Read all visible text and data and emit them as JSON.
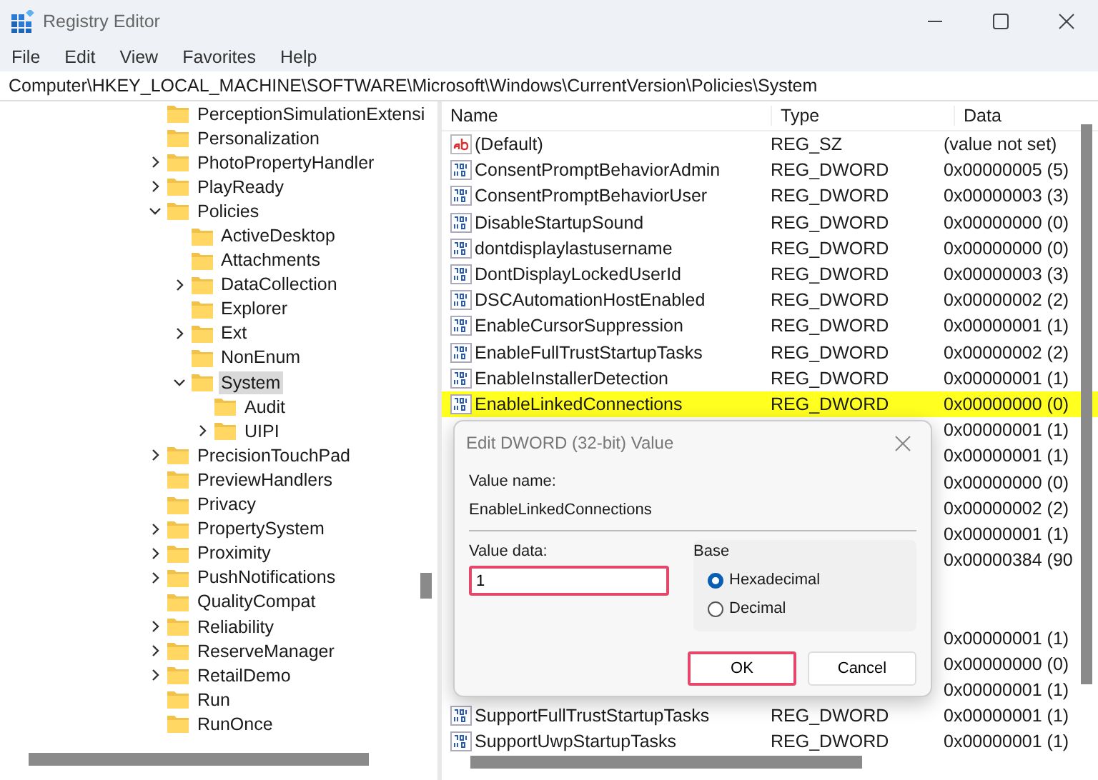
{
  "window": {
    "title": "Registry Editor"
  },
  "menu": [
    "File",
    "Edit",
    "View",
    "Favorites",
    "Help"
  ],
  "address": "Computer\\HKEY_LOCAL_MACHINE\\SOFTWARE\\Microsoft\\Windows\\CurrentVersion\\Policies\\System",
  "tree": [
    {
      "label": "PerceptionSimulationExtensi",
      "has_children": false,
      "selected": false
    },
    {
      "label": "Personalization",
      "has_children": false,
      "selected": false
    },
    {
      "label": "PhotoPropertyHandler",
      "has_children": true,
      "expanded": false,
      "selected": false
    },
    {
      "label": "PlayReady",
      "has_children": true,
      "expanded": false,
      "selected": false
    },
    {
      "label": "Policies",
      "has_children": true,
      "expanded": true,
      "selected": false,
      "children": [
        {
          "label": "ActiveDesktop",
          "has_children": false,
          "selected": false
        },
        {
          "label": "Attachments",
          "has_children": false,
          "selected": false
        },
        {
          "label": "DataCollection",
          "has_children": true,
          "expanded": false,
          "selected": false
        },
        {
          "label": "Explorer",
          "has_children": false,
          "selected": false
        },
        {
          "label": "Ext",
          "has_children": true,
          "expanded": false,
          "selected": false
        },
        {
          "label": "NonEnum",
          "has_children": false,
          "selected": false
        },
        {
          "label": "System",
          "has_children": true,
          "expanded": true,
          "selected": true,
          "children": [
            {
              "label": "Audit",
              "has_children": false,
              "selected": false
            },
            {
              "label": "UIPI",
              "has_children": true,
              "expanded": false,
              "selected": false
            }
          ]
        }
      ]
    },
    {
      "label": "PrecisionTouchPad",
      "has_children": true,
      "expanded": false,
      "selected": false
    },
    {
      "label": "PreviewHandlers",
      "has_children": false,
      "selected": false
    },
    {
      "label": "Privacy",
      "has_children": false,
      "selected": false
    },
    {
      "label": "PropertySystem",
      "has_children": true,
      "expanded": false,
      "selected": false
    },
    {
      "label": "Proximity",
      "has_children": true,
      "expanded": false,
      "selected": false
    },
    {
      "label": "PushNotifications",
      "has_children": true,
      "expanded": false,
      "selected": false
    },
    {
      "label": "QualityCompat",
      "has_children": false,
      "selected": false
    },
    {
      "label": "Reliability",
      "has_children": true,
      "expanded": false,
      "selected": false
    },
    {
      "label": "ReserveManager",
      "has_children": true,
      "expanded": false,
      "selected": false
    },
    {
      "label": "RetailDemo",
      "has_children": true,
      "expanded": false,
      "selected": false
    },
    {
      "label": "Run",
      "has_children": false,
      "selected": false
    },
    {
      "label": "RunOnce",
      "has_children": false,
      "selected": false
    }
  ],
  "table": {
    "columns": [
      "Name",
      "Type",
      "Data"
    ],
    "rows": [
      {
        "kind": "string",
        "name": "(Default)",
        "type": "REG_SZ",
        "data": "(value not set)",
        "selected": false
      },
      {
        "kind": "dword",
        "name": "ConsentPromptBehaviorAdmin",
        "type": "REG_DWORD",
        "data": "0x00000005 (5)",
        "selected": false
      },
      {
        "kind": "dword",
        "name": "ConsentPromptBehaviorUser",
        "type": "REG_DWORD",
        "data": "0x00000003 (3)",
        "selected": false
      },
      {
        "kind": "dword",
        "name": "DisableStartupSound",
        "type": "REG_DWORD",
        "data": "0x00000000 (0)",
        "selected": false
      },
      {
        "kind": "dword",
        "name": "dontdisplaylastusername",
        "type": "REG_DWORD",
        "data": "0x00000000 (0)",
        "selected": false
      },
      {
        "kind": "dword",
        "name": "DontDisplayLockedUserId",
        "type": "REG_DWORD",
        "data": "0x00000003 (3)",
        "selected": false
      },
      {
        "kind": "dword",
        "name": "DSCAutomationHostEnabled",
        "type": "REG_DWORD",
        "data": "0x00000002 (2)",
        "selected": false
      },
      {
        "kind": "dword",
        "name": "EnableCursorSuppression",
        "type": "REG_DWORD",
        "data": "0x00000001 (1)",
        "selected": false
      },
      {
        "kind": "dword",
        "name": "EnableFullTrustStartupTasks",
        "type": "REG_DWORD",
        "data": "0x00000002 (2)",
        "selected": false
      },
      {
        "kind": "dword",
        "name": "EnableInstallerDetection",
        "type": "REG_DWORD",
        "data": "0x00000001 (1)",
        "selected": false
      },
      {
        "kind": "dword",
        "name": "EnableLinkedConnections",
        "type": "REG_DWORD",
        "data": "0x00000000 (0)",
        "selected": true
      },
      {
        "data": "0x00000001 (1)",
        "selected": false
      },
      {
        "data": "0x00000001 (1)",
        "selected": false
      },
      {
        "data": "0x00000000 (0)",
        "selected": false
      },
      {
        "data": "0x00000002 (2)",
        "selected": false
      },
      {
        "data": "0x00000001 (1)",
        "selected": false
      },
      {
        "data": "0x00000384 (90",
        "selected": false
      },
      {},
      {},
      {
        "data": "0x00000001 (1)",
        "selected": false
      },
      {
        "data": "0x00000000 (0)",
        "selected": false
      },
      {
        "data": "0x00000001 (1)",
        "selected": false
      },
      {
        "kind": "dword",
        "name": "SupportFullTrustStartupTasks",
        "type": "REG_DWORD",
        "data": "0x00000001 (1)",
        "selected": false
      },
      {
        "kind": "dword",
        "name": "SupportUwpStartupTasks",
        "type": "REG_DWORD",
        "data": "0x00000001 (1)",
        "selected": false
      }
    ]
  },
  "dialog": {
    "title": "Edit DWORD (32-bit) Value",
    "value_name_label": "Value name:",
    "value_name": "EnableLinkedConnections",
    "value_data_label": "Value data:",
    "value_data": "1",
    "value_data_highlighted": true,
    "base_label": "Base",
    "base_options": [
      {
        "label": "Hexadecimal",
        "selected": true
      },
      {
        "label": "Decimal",
        "selected": false
      }
    ],
    "buttons": [
      {
        "label": "OK",
        "highlighted": true
      },
      {
        "label": "Cancel",
        "highlighted": false
      }
    ]
  }
}
